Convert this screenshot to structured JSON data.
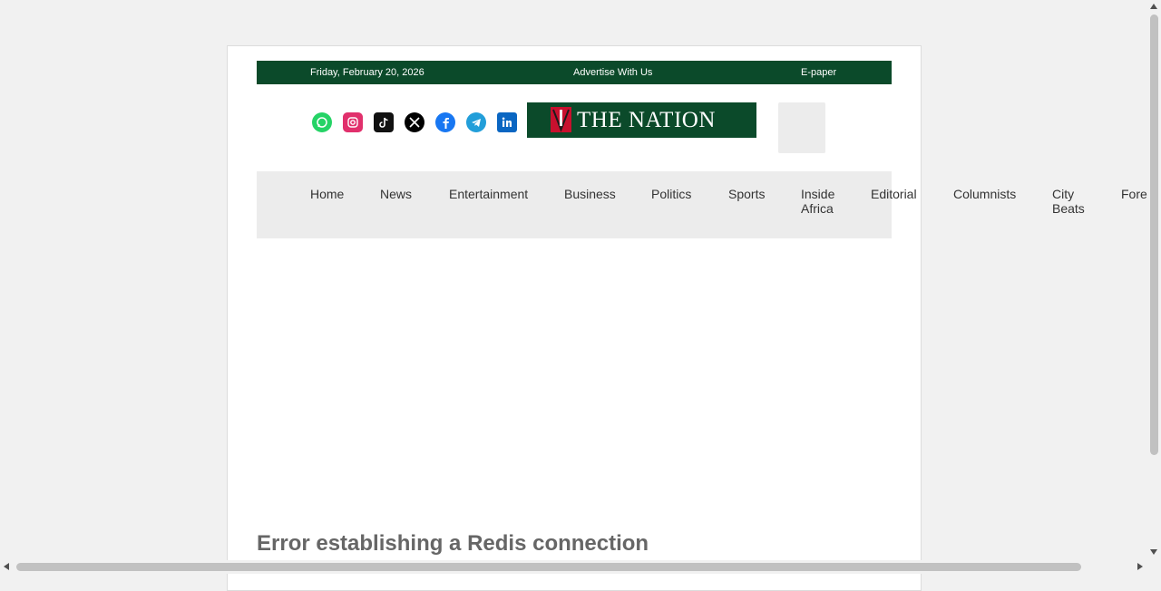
{
  "topbar": {
    "date": "Friday, February 20, 2026",
    "advertise": "Advertise With Us",
    "epaper": "E-paper",
    "background": "#0b4a2a"
  },
  "social": [
    {
      "icon": "whatsapp-icon",
      "color": "#25d366"
    },
    {
      "icon": "instagram-icon",
      "color": "#e1306c"
    },
    {
      "icon": "tiktok-icon",
      "color": "#111111"
    },
    {
      "icon": "x-icon",
      "color": "#000000"
    },
    {
      "icon": "facebook-icon",
      "color": "#1877f2"
    },
    {
      "icon": "telegram-icon",
      "color": "#229ed9"
    },
    {
      "icon": "linkedin-icon",
      "color": "#0a66c2"
    }
  ],
  "logo": {
    "text": "THE NATION",
    "background": "#0b4a2a"
  },
  "nav": {
    "items": [
      {
        "label": "Home"
      },
      {
        "label": "News"
      },
      {
        "label": "Entertainment"
      },
      {
        "label": "Business"
      },
      {
        "label": "Politics"
      },
      {
        "label": "Sports"
      },
      {
        "label": "Inside Africa"
      },
      {
        "label": "Editorial"
      },
      {
        "label": "Columnists"
      },
      {
        "label": "City Beats"
      },
      {
        "label": "Fore"
      }
    ]
  },
  "main": {
    "error": "Error establishing a Redis connection"
  }
}
